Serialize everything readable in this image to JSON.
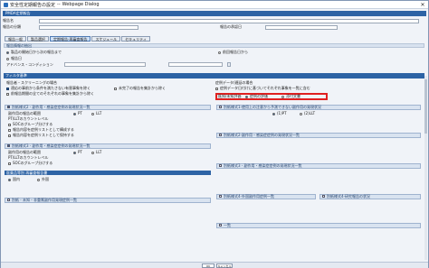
{
  "window": {
    "title": "安全性定期報告の設定",
    "separator": "--",
    "subtitle": "Webpage Dialog",
    "close": "✕"
  },
  "header": {
    "bar": "PMDA定期報告"
  },
  "fields": [
    {
      "label": "報告名"
    },
    {
      "label": "報告の分類"
    },
    {
      "label": "報告の承認日"
    }
  ],
  "tabs": [
    "報告一般",
    "製品選択",
    "定期報告-再審査報告",
    "スケジュール",
    "セキュリティ"
  ],
  "period_section": {
    "title": "報告情報の抽出",
    "radio1": "製品の開始日から次の報告まで",
    "radio2": "前回報告日から",
    "radio3": "報告日",
    "date_from": "基準日",
    "compound": "アドバンス・コンディション"
  },
  "filter": {
    "title": "フィルタ基準",
    "left_head": "報告者・スクリーニングの場合",
    "left_items": [
      "適応の事前から条件を満たさない有害事象を除く",
      "未完了の報告を集計から除く",
      "前報告期間の全てのそれぞれの事象を集計から除く"
    ],
    "right_head": "症例データ/遅延の場合",
    "right_items": [
      "症例データ日付けに基づいてそれぞれ事象を一覧に含む",
      "既報の判断を事例の基準に含める"
    ],
    "highlight_label": "既知/未知評価",
    "highlight_value": "症例の評価",
    "highlight_value2": "添付文書"
  },
  "panels": {
    "left1": "別紙様式2 - 副作用・感染症症例の発現状況一覧",
    "left1_items": [
      "副作用の報告の範囲",
      "PT/LLTのカウントレベル",
      "SOCのグループ分けする",
      "報告内容を症例リストとして構成する",
      "報告内容を症例リストとして保持する"
    ],
    "left2": "別紙様式3 - 副作用・感染症症例の発現状況一覧",
    "left2_items": [
      "副作用の報告の範囲",
      "PT/LLTのカウントレベル",
      "SOCのグループ分けする"
    ],
    "left3": "医薬品等別 再審査報告書",
    "left4": "別紙 - 未知・非重篤副作用発現症例一覧",
    "right1": "別紙様式1-使用上の注意から予測できない副作用の発現状況",
    "right2": "別紙様式2-副作用・感染症症例の発現状況一覧",
    "right3": "別紙様式3 - 副作用・感染症症例の発現状況一覧",
    "right4": "別紙様式4-外国副作用症例一覧",
    "right5": "別紙様式4-研究報告の状況",
    "right6": "一覧"
  },
  "radio_counts": [
    "PT",
    "LLT"
  ],
  "counts_right": [
    "(1)PT",
    "(2)LLT"
  ],
  "report_type": {
    "label1": "国内",
    "label2": "外国"
  },
  "footer": {
    "ok": "OK",
    "cancel": "キャンセル"
  }
}
